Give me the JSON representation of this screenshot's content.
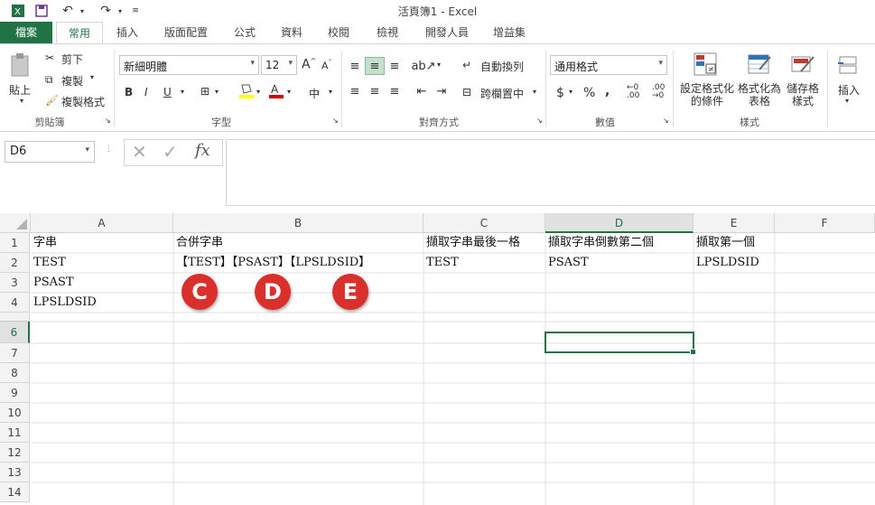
{
  "title": "活頁簿1 - Excel",
  "tabs": [
    "檔案",
    "常用",
    "插入",
    "版面配置",
    "公式",
    "資料",
    "校閱",
    "檢視",
    "開發人員",
    "增益集"
  ],
  "ribbon": {
    "clipboard": {
      "paste": "貼上",
      "cut": "剪下",
      "copy": "複製",
      "format_painter": "複製格式",
      "label": "剪貼簿"
    },
    "font": {
      "name": "新細明體",
      "size": "12",
      "label": "字型"
    },
    "alignment": {
      "wrap": "自動換列",
      "merge": "跨欄置中",
      "label": "對齊方式"
    },
    "number": {
      "format": "通用格式",
      "label": "數值"
    },
    "styles": {
      "conditional": "設定格式化的條件",
      "table": "格式化為表格",
      "cell_styles": "儲存格樣式",
      "label": "樣式"
    },
    "cells": {
      "insert": "插入"
    }
  },
  "namebox": "D6",
  "columns": [
    "A",
    "B",
    "C",
    "D",
    "E",
    "F"
  ],
  "rows": [
    "1",
    "2",
    "3",
    "4",
    "6",
    "7",
    "8",
    "9",
    "10",
    "11",
    "12",
    "13",
    "14"
  ],
  "cells": {
    "A1": "字串",
    "B1": "合併字串",
    "C1": "擷取字串最後一格",
    "D1": "擷取字串倒數第二個",
    "E1": "擷取第一個",
    "A2": "TEST",
    "B2": "【TEST】【PSAST】【LPSLDSID】",
    "C2": "TEST",
    "D2": "PSAST",
    "E2": "LPSLDSID",
    "A3": "PSAST",
    "A4": "LPSLDSID"
  },
  "markers": [
    "C",
    "D",
    "E"
  ],
  "accent": "#217346",
  "marker_color": "#d9302b"
}
